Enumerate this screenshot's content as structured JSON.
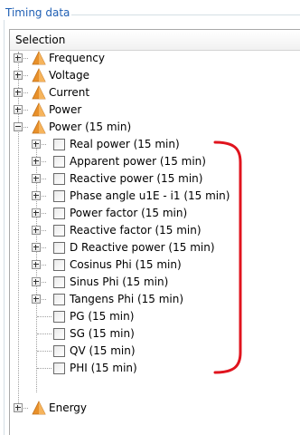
{
  "group_title": "Timing data",
  "header": {
    "label": "Selection"
  },
  "top_nodes": [
    {
      "label": "Frequency"
    },
    {
      "label": "Voltage"
    },
    {
      "label": "Current"
    },
    {
      "label": "Power"
    },
    {
      "label": "Power (15 min)"
    }
  ],
  "children": [
    {
      "label": "Real power (15 min)"
    },
    {
      "label": "Apparent power (15 min)"
    },
    {
      "label": "Reactive power (15 min)"
    },
    {
      "label": "Phase angle u1E - i1 (15 min)"
    },
    {
      "label": "Power factor (15 min)"
    },
    {
      "label": "Reactive factor (15 min)"
    },
    {
      "label": "D Reactive power (15 min)"
    },
    {
      "label": "Cosinus Phi (15 min)"
    },
    {
      "label": "Sinus Phi (15 min)"
    },
    {
      "label": "Tangens Phi (15 min)"
    },
    {
      "label": "PG (15 min)"
    },
    {
      "label": "SG (15 min)"
    },
    {
      "label": "QV (15 min)"
    },
    {
      "label": "PHI (15 min)"
    }
  ],
  "last_node": {
    "label": "Energy"
  },
  "colors": {
    "annotation": "#e0141e",
    "title": "#1f5fb4",
    "icon": "#e8902a"
  },
  "icons": {
    "node": "warning-triangle-icon",
    "expander": "plus-box-icon"
  }
}
